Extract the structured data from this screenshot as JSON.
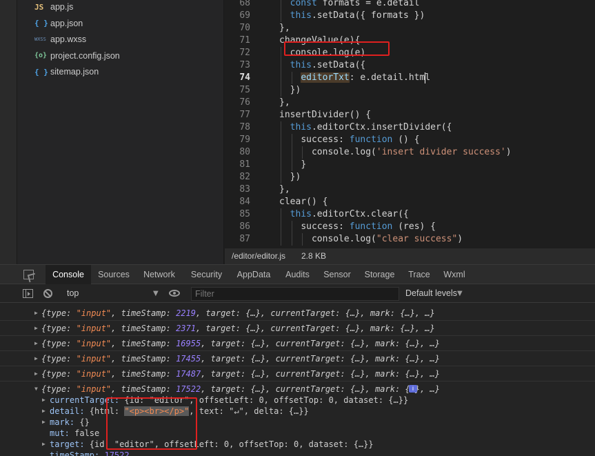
{
  "file_tree": {
    "items": [
      {
        "icon": "JS",
        "name": "app.js"
      },
      {
        "icon": "{ }",
        "name": "app.json"
      },
      {
        "icon": "WXSS",
        "name": "app.wxss"
      },
      {
        "icon": "{o}",
        "name": "project.config.json"
      },
      {
        "icon": "{ }",
        "name": "sitemap.json"
      }
    ]
  },
  "editor": {
    "active_line": "74",
    "lines": [
      {
        "n": "68",
        "t": [
          [
            "kw",
            "const "
          ],
          [
            "pl",
            "formats = e.detail"
          ]
        ]
      },
      {
        "n": "69",
        "t": [
          [
            "kw",
            "this"
          ],
          [
            "pl",
            ".setData({ formats })"
          ]
        ]
      },
      {
        "n": "70",
        "t": [
          [
            "pl",
            "},"
          ]
        ]
      },
      {
        "n": "71",
        "t": [
          [
            "pl",
            "changeValue(e){"
          ]
        ]
      },
      {
        "n": "72",
        "t": [
          [
            "pl",
            "console.log(e)"
          ]
        ]
      },
      {
        "n": "73",
        "t": [
          [
            "kw",
            "this"
          ],
          [
            "pl",
            ".setData({"
          ]
        ]
      },
      {
        "n": "74",
        "t": [
          [
            "hl",
            "editorTxt"
          ],
          [
            "pl",
            ": e.detail.html"
          ]
        ]
      },
      {
        "n": "75",
        "t": [
          [
            "pl",
            "})"
          ]
        ]
      },
      {
        "n": "76",
        "t": [
          [
            "pl",
            "},"
          ]
        ]
      },
      {
        "n": "77",
        "t": [
          [
            "pl",
            "insertDivider() {"
          ]
        ]
      },
      {
        "n": "78",
        "t": [
          [
            "kw",
            "this"
          ],
          [
            "pl",
            ".editorCtx.insertDivider({"
          ]
        ]
      },
      {
        "n": "79",
        "t": [
          [
            "pl",
            "success: "
          ],
          [
            "kw",
            "function"
          ],
          [
            "pl",
            " () {"
          ]
        ]
      },
      {
        "n": "80",
        "t": [
          [
            "pl",
            "console.log("
          ],
          [
            "str",
            "'insert divider success'"
          ],
          [
            "pl",
            ")"
          ]
        ]
      },
      {
        "n": "81",
        "t": [
          [
            "pl",
            "}"
          ]
        ]
      },
      {
        "n": "82",
        "t": [
          [
            "pl",
            "})"
          ]
        ]
      },
      {
        "n": "83",
        "t": [
          [
            "pl",
            "},"
          ]
        ]
      },
      {
        "n": "84",
        "t": [
          [
            "pl",
            "clear() {"
          ]
        ]
      },
      {
        "n": "85",
        "t": [
          [
            "kw",
            "this"
          ],
          [
            "pl",
            ".editorCtx.clear({"
          ]
        ]
      },
      {
        "n": "86",
        "t": [
          [
            "pl",
            "success: "
          ],
          [
            "kw",
            "function"
          ],
          [
            "pl",
            " (res) {"
          ]
        ]
      },
      {
        "n": "87",
        "t": [
          [
            "pl",
            "console.log("
          ],
          [
            "str",
            "\"clear success\""
          ],
          [
            "pl",
            ")"
          ]
        ]
      }
    ]
  },
  "status_bar": {
    "path": "/editor/editor.js",
    "size": "2.8 KB"
  },
  "devtools": {
    "tabs": [
      "Console",
      "Sources",
      "Network",
      "Security",
      "AppData",
      "Audits",
      "Sensor",
      "Storage",
      "Trace",
      "Wxml"
    ],
    "active_tab": "Console"
  },
  "console_toolbar": {
    "context": "top",
    "filter_placeholder": "Filter",
    "levels": "Default levels"
  },
  "console": {
    "collapsed_logs": [
      {
        "type": "\"input\"",
        "timeStamp": "2219"
      },
      {
        "type": "\"input\"",
        "timeStamp": "2371"
      },
      {
        "type": "\"input\"",
        "timeStamp": "16955"
      },
      {
        "type": "\"input\"",
        "timeStamp": "17455"
      },
      {
        "type": "\"input\"",
        "timeStamp": "17487"
      }
    ],
    "expanded_log": {
      "type": "\"input\"",
      "timeStamp": "17522"
    },
    "log_suffix": ", target: {…}, currentTarget: {…}, mark: {…}, …}",
    "log_prefix_type": "{type: ",
    "log_prefix_ts": ", timeStamp: ",
    "info_badge": "i",
    "properties": {
      "currentTarget": "{id: \"editor\", offsetLeft: 0, offsetTop: 0, dataset: {…}}",
      "detail_html": "\"<p><br></p>\"",
      "detail_rest": ", text: \"↵\", delta: {…}}",
      "mark": "{}",
      "mut": "false",
      "target": "{id: \"editor\", offsetLeft: 0, offsetTop: 0, dataset: {…}}",
      "timeStamp": "17522"
    }
  },
  "colors": {
    "keyword": "#569cd6",
    "string": "#ce9178",
    "console_string": "#f28b54",
    "console_number": "#9980ff",
    "annotation_red": "#e0201f"
  }
}
